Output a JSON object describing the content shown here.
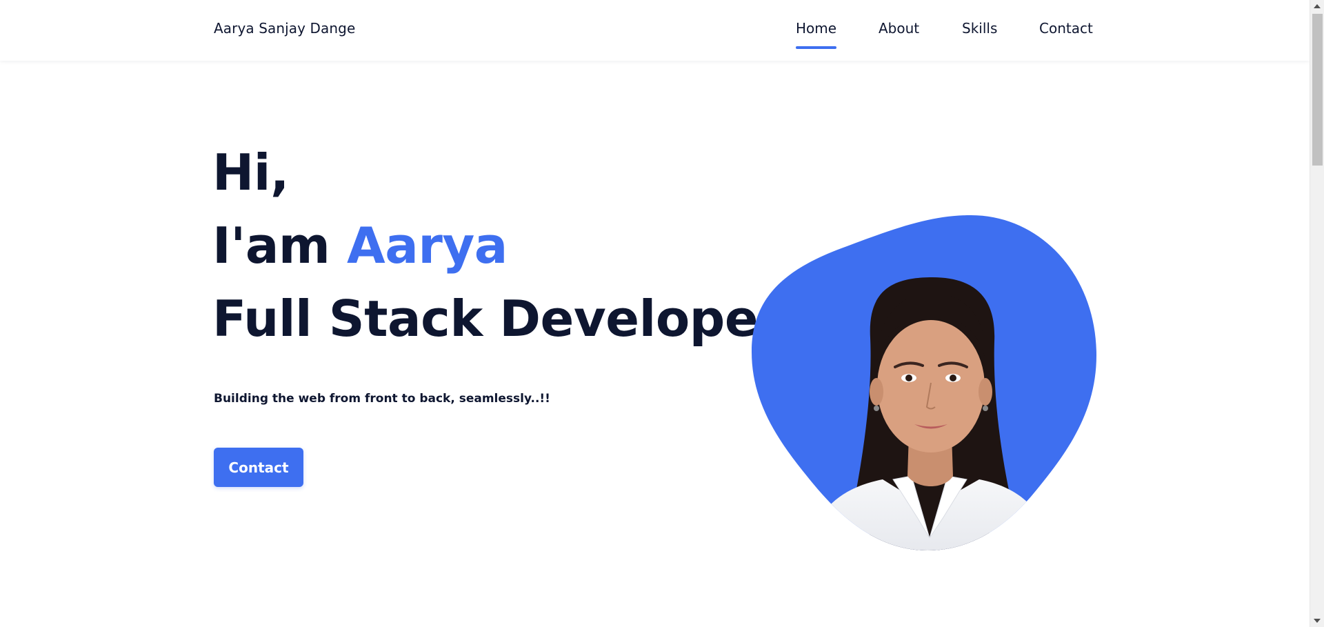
{
  "header": {
    "logo": "Aarya Sanjay Dange",
    "nav": [
      {
        "label": "Home",
        "active": true
      },
      {
        "label": "About",
        "active": false
      },
      {
        "label": "Skills",
        "active": false
      },
      {
        "label": "Contact",
        "active": false
      }
    ]
  },
  "hero": {
    "greeting": "Hi,",
    "intro_prefix": "I'am ",
    "name": "Aarya",
    "role": "Full Stack Developer",
    "tagline": "Building the web from front to back, seamlessly..!!",
    "cta_label": "Contact"
  },
  "colors": {
    "accent": "#3e6ff0",
    "text_dark": "#0e1630",
    "background": "#ffffff"
  },
  "icons": {
    "scroll_up": "triangle-up-icon",
    "scroll_down": "triangle-down-icon"
  }
}
